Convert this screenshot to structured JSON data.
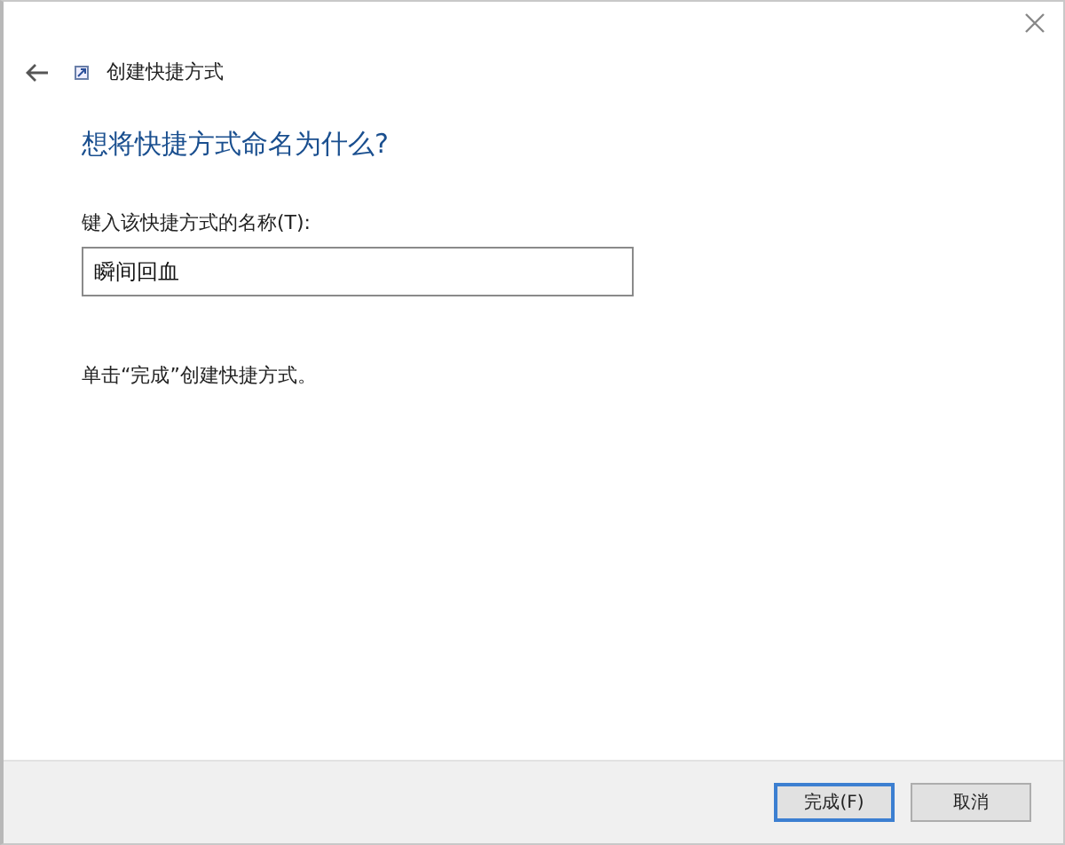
{
  "window": {
    "title": "创建快捷方式"
  },
  "heading": "想将快捷方式命名为什么?",
  "name_field": {
    "label": "键入该快捷方式的名称(T):",
    "value": "瞬间回血"
  },
  "instruction": "单击“完成”创建快捷方式。",
  "buttons": [
    {
      "label": "完成(F)",
      "default": true
    },
    {
      "label": "取消",
      "default": false
    }
  ]
}
